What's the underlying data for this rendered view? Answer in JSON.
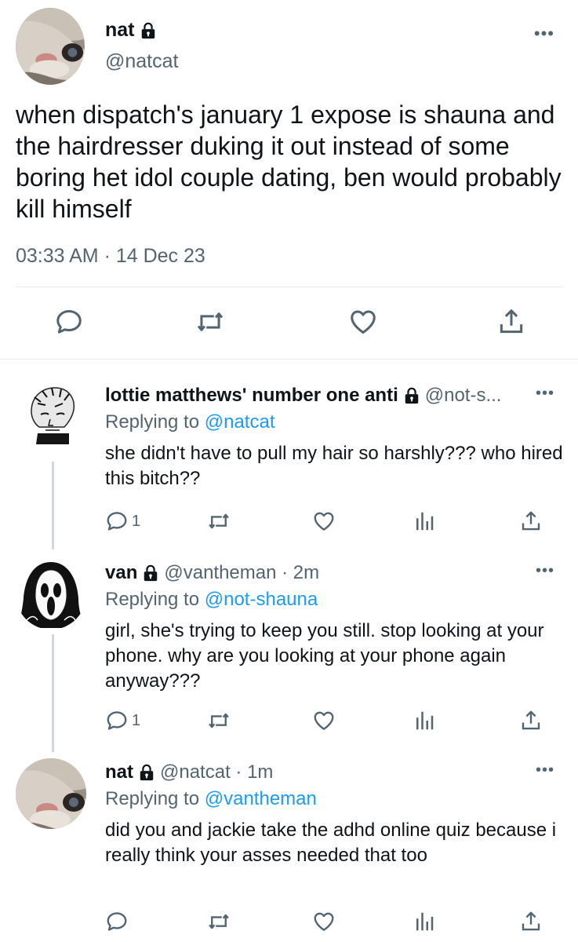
{
  "main_tweet": {
    "name": "nat",
    "handle": "@natcat",
    "more": "•••",
    "text": "when dispatch's january 1 expose is shauna and the hairdresser duking it out instead of some boring het idol couple dating, ben would probably kill himself",
    "timestamp": "03:33 AM · 14 Dec 23",
    "icons": [
      "reply-icon",
      "retweet-icon",
      "like-icon",
      "share-icon"
    ]
  },
  "replies": [
    {
      "name": "lottie matthews' number one anti",
      "handle": "@not-s...",
      "replying_prefix": "Replying to ",
      "replying_to": "@natcat",
      "text": "she didn't have to pull my hair so harshly??? who hired this bitch??",
      "reply_count": "1",
      "more": "•••"
    },
    {
      "name": "van",
      "handle": "@vantheman · 2m",
      "replying_prefix": "Replying to ",
      "replying_to": "@not-shauna",
      "text": "girl, she's trying to keep you still. stop looking at your phone. why are you looking at your phone again anyway???",
      "reply_count": "1",
      "more": "•••"
    },
    {
      "name": "nat",
      "handle": "@natcat · 1m",
      "replying_prefix": "Replying to ",
      "replying_to": "@vantheman",
      "text": "did you and jackie take the adhd online quiz because i really think your asses needed that too",
      "reply_count": "",
      "more": "•••"
    }
  ],
  "colors": {
    "text": "#0f1419",
    "secondary": "#536471",
    "link": "#1d9bf0",
    "divider": "#e6e9ec"
  }
}
